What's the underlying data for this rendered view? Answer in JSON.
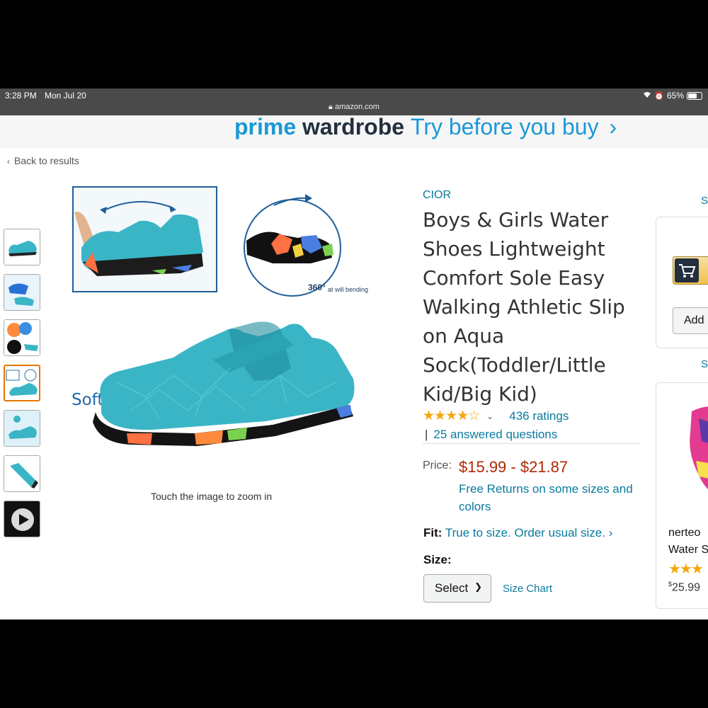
{
  "status_bar": {
    "time": "3:28 PM",
    "date": "Mon Jul 20",
    "battery": "65%",
    "url": "amazon.com"
  },
  "banner": {
    "prime": "prime",
    "wardrobe": "wardrobe",
    "tagline": "Try before you buy",
    "chevron": "›"
  },
  "nav": {
    "back": "Back to results"
  },
  "gallery": {
    "image_caption": "Soft and easy to bend",
    "badge_text": "360°",
    "badge_sub": "at will bending",
    "zoom_hint": "Touch the image to zoom in",
    "active_thumb_index": 3
  },
  "product": {
    "brand": "CIOR",
    "title": "Boys & Girls Water Shoes Lightweight Comfort Sole Easy Walking Athletic Slip on Aqua Sock(Toddler/Little Kid/Big Kid)",
    "stars": "★★★★☆",
    "rating_value": 4.5,
    "ratings_count": "436 ratings",
    "answered_questions": "25 answered questions",
    "price_label": "Price:",
    "price": "$15.99 - $21.87",
    "free_returns": "Free Returns on some sizes and colors",
    "fit_label": "Fit:",
    "fit_text": "True to size. Order usual size. ›",
    "size_label": "Size:",
    "size_select": "Select",
    "size_chart": "Size Chart"
  },
  "right_column": {
    "link_1": "S",
    "link_2": "S",
    "add_button": "Add",
    "recommendation": {
      "title_line1": "nerteo",
      "title_line2": "Water S",
      "stars": "★★★",
      "price_symbol": "$",
      "price": "25.99"
    }
  },
  "colors": {
    "accent_blue": "#0a7a9e",
    "price_red": "#b12704",
    "star_orange": "#f4a70b",
    "thumb_active": "#e77600",
    "shoe_teal": "#3ab5c6"
  }
}
